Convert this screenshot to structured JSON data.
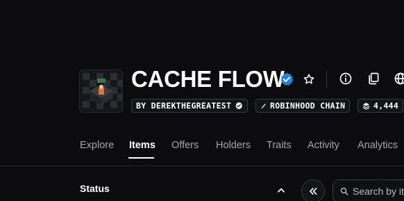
{
  "collection": {
    "title": "CACHE FLOW",
    "creator_chip": "BY DEREKTHEGREATEST",
    "chain_chip": "ROBINHOOD CHAIN",
    "items_chip": "4,444"
  },
  "tabs": [
    {
      "label": "Explore"
    },
    {
      "label": "Items",
      "active": true
    },
    {
      "label": "Offers"
    },
    {
      "label": "Holders"
    },
    {
      "label": "Traits"
    },
    {
      "label": "Activity"
    },
    {
      "label": "Analytics"
    }
  ],
  "filters": {
    "status_label": "Status"
  },
  "search": {
    "placeholder": "Search by it"
  },
  "icons": {
    "verified": "verified-badge-icon",
    "star": "star-icon",
    "info": "info-icon",
    "copy": "copy-icon",
    "globe": "globe-icon",
    "chain": "chain-icon",
    "stack": "stack-icon",
    "chevron": "chevron-up-icon",
    "collapse": "double-chevron-left-icon",
    "search": "search-icon"
  },
  "colors": {
    "background": "#0c0c0e",
    "verified_blue": "#2081e2",
    "muted_text": "#a4a6ad"
  }
}
